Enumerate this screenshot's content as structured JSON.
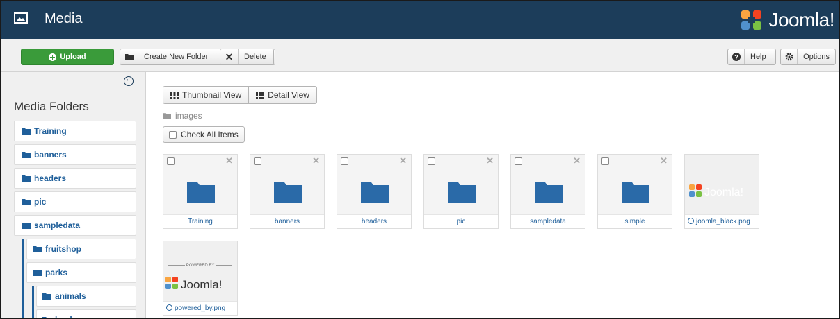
{
  "header": {
    "title": "Media",
    "brand": "Joomla!"
  },
  "toolbar": {
    "upload_label": "Upload",
    "new_folder_label": "Create New Folder",
    "delete_label": "Delete",
    "help_label": "Help",
    "options_label": "Options"
  },
  "sidebar": {
    "heading": "Media Folders",
    "items": [
      {
        "label": "Training"
      },
      {
        "label": "banners"
      },
      {
        "label": "headers"
      },
      {
        "label": "pic"
      },
      {
        "label": "sampledata"
      },
      {
        "label": "fruitshop"
      },
      {
        "label": "parks"
      },
      {
        "label": "animals"
      },
      {
        "label": "landscape"
      }
    ]
  },
  "main": {
    "thumbnail_view_label": "Thumbnail View",
    "detail_view_label": "Detail View",
    "breadcrumb": "images",
    "check_all_label": "Check All Items",
    "folders": [
      "Training",
      "banners",
      "headers",
      "pic",
      "sampledata",
      "simple"
    ],
    "images": [
      "joomla_black.png",
      "powered_by.png"
    ],
    "powered_by_text": "POWERED BY"
  },
  "colors": {
    "header_bg": "#1c3d5a",
    "upload_green": "#3a9b3a",
    "link_blue": "#1f5f9a"
  }
}
